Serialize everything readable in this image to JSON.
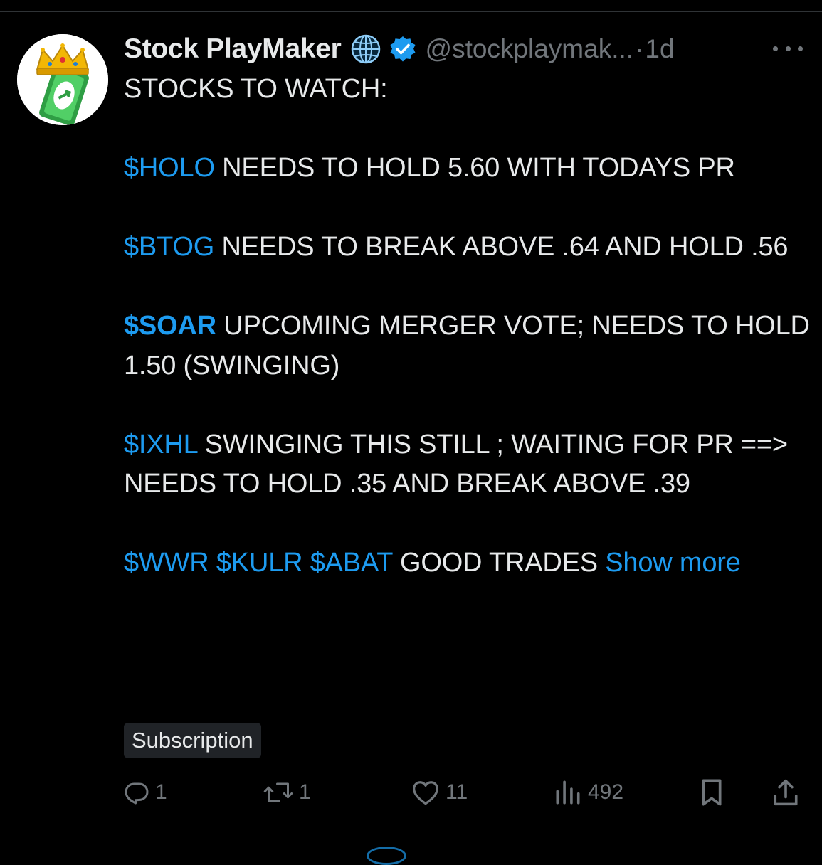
{
  "post": {
    "display_name": "Stock PlayMaker",
    "handle": "@stockplaymak...",
    "separator": "·",
    "time": "1d",
    "text": {
      "intro": "STOCKS TO WATCH:",
      "p1": {
        "tag": "$HOLO",
        "body": " NEEDS TO HOLD 5.60 WITH TODAYS PR"
      },
      "p2": {
        "tag": "$BTOG",
        "body": " NEEDS TO BREAK ABOVE .64 AND HOLD .56"
      },
      "p3": {
        "tag": "$SOAR",
        "body": " UPCOMING MERGER VOTE; NEEDS TO HOLD 1.50 (SWINGING)"
      },
      "p4": {
        "tag": "$IXHL",
        "body": " SWINGING THIS STILL ; WAITING FOR PR ==> NEEDS TO HOLD .35 AND BREAK ABOVE .39"
      },
      "p5": {
        "tag1": "$WWR",
        "tag2": "$KULR",
        "tag3": "$ABAT",
        "body": " GOOD TRADES ",
        "show_more": "Show more"
      }
    },
    "badge": "Subscription"
  },
  "actions": {
    "replies": "1",
    "reposts": "1",
    "likes": "11",
    "views": "492"
  },
  "icons": {
    "globe": "globe-icon",
    "verified": "verified-badge-icon",
    "more": "more-horizontal-icon",
    "reply": "reply-icon",
    "repost": "repost-icon",
    "like": "heart-icon",
    "views": "views-chart-icon",
    "bookmark": "bookmark-icon",
    "share": "share-icon"
  },
  "colors": {
    "background": "#000000",
    "text": "#e7e9ea",
    "muted": "#71767b",
    "accent": "#1d9bf0",
    "divider": "#2f3336",
    "badge_bg": "#202327"
  }
}
